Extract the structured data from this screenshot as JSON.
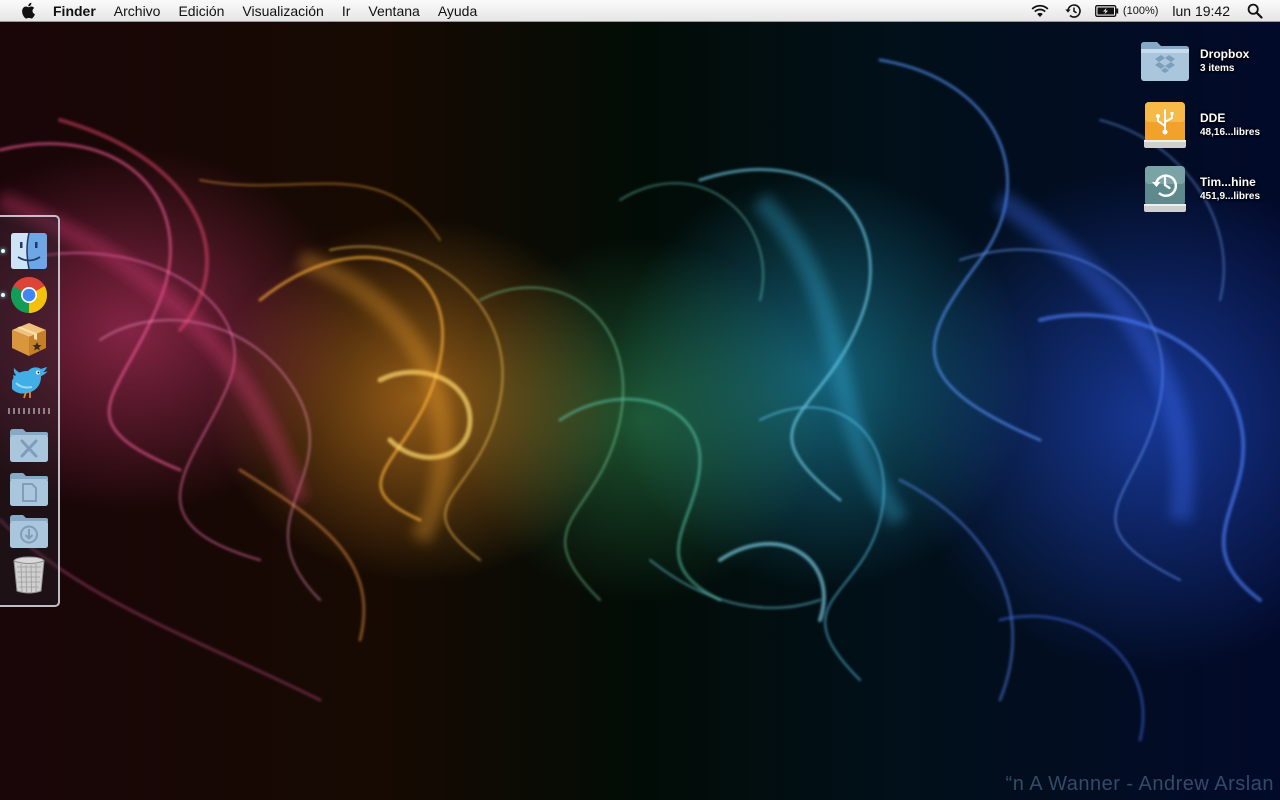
{
  "menubar": {
    "apple_icon": "apple-icon",
    "app_name": "Finder",
    "items": [
      "Archivo",
      "Edición",
      "Visualización",
      "Ir",
      "Ventana",
      "Ayuda"
    ],
    "status": {
      "wifi_icon": "wifi-icon",
      "time_machine_icon": "time-machine-icon",
      "battery_icon": "battery-charging-icon",
      "battery_text": "(100%)",
      "clock": "lun 19:42",
      "spotlight_icon": "spotlight-search-icon"
    }
  },
  "desktop_icons": [
    {
      "name": "Dropbox",
      "sub": "3 items",
      "icon": "dropbox-folder-icon"
    },
    {
      "name": "DDE",
      "sub": "48,16...libres",
      "icon": "usb-drive-icon"
    },
    {
      "name": "Tim...hine",
      "sub": "451,9...libres",
      "icon": "time-machine-drive-icon"
    }
  ],
  "dock": {
    "position": "left",
    "items": [
      {
        "name": "Finder",
        "icon": "finder-icon",
        "running": true
      },
      {
        "name": "Google Chrome",
        "icon": "chrome-icon",
        "running": true
      },
      {
        "name": "Delivery package app",
        "icon": "package-icon",
        "running": false
      },
      {
        "name": "Twitter",
        "icon": "twitter-bird-icon",
        "running": false
      },
      {
        "name": "Utilities folder",
        "icon": "utilities-folder-icon",
        "running": false
      },
      {
        "name": "Documents folder",
        "icon": "documents-folder-icon",
        "running": false
      },
      {
        "name": "Downloads folder",
        "icon": "downloads-folder-icon",
        "running": false
      },
      {
        "name": "Trash",
        "icon": "trash-icon",
        "running": false
      }
    ]
  },
  "wallpaper": {
    "credit": "“n A Wanner - Andrew Arslan",
    "colors": [
      "#e0407a",
      "#ffa030",
      "#40b070",
      "#30b8e0",
      "#3060f0"
    ]
  }
}
